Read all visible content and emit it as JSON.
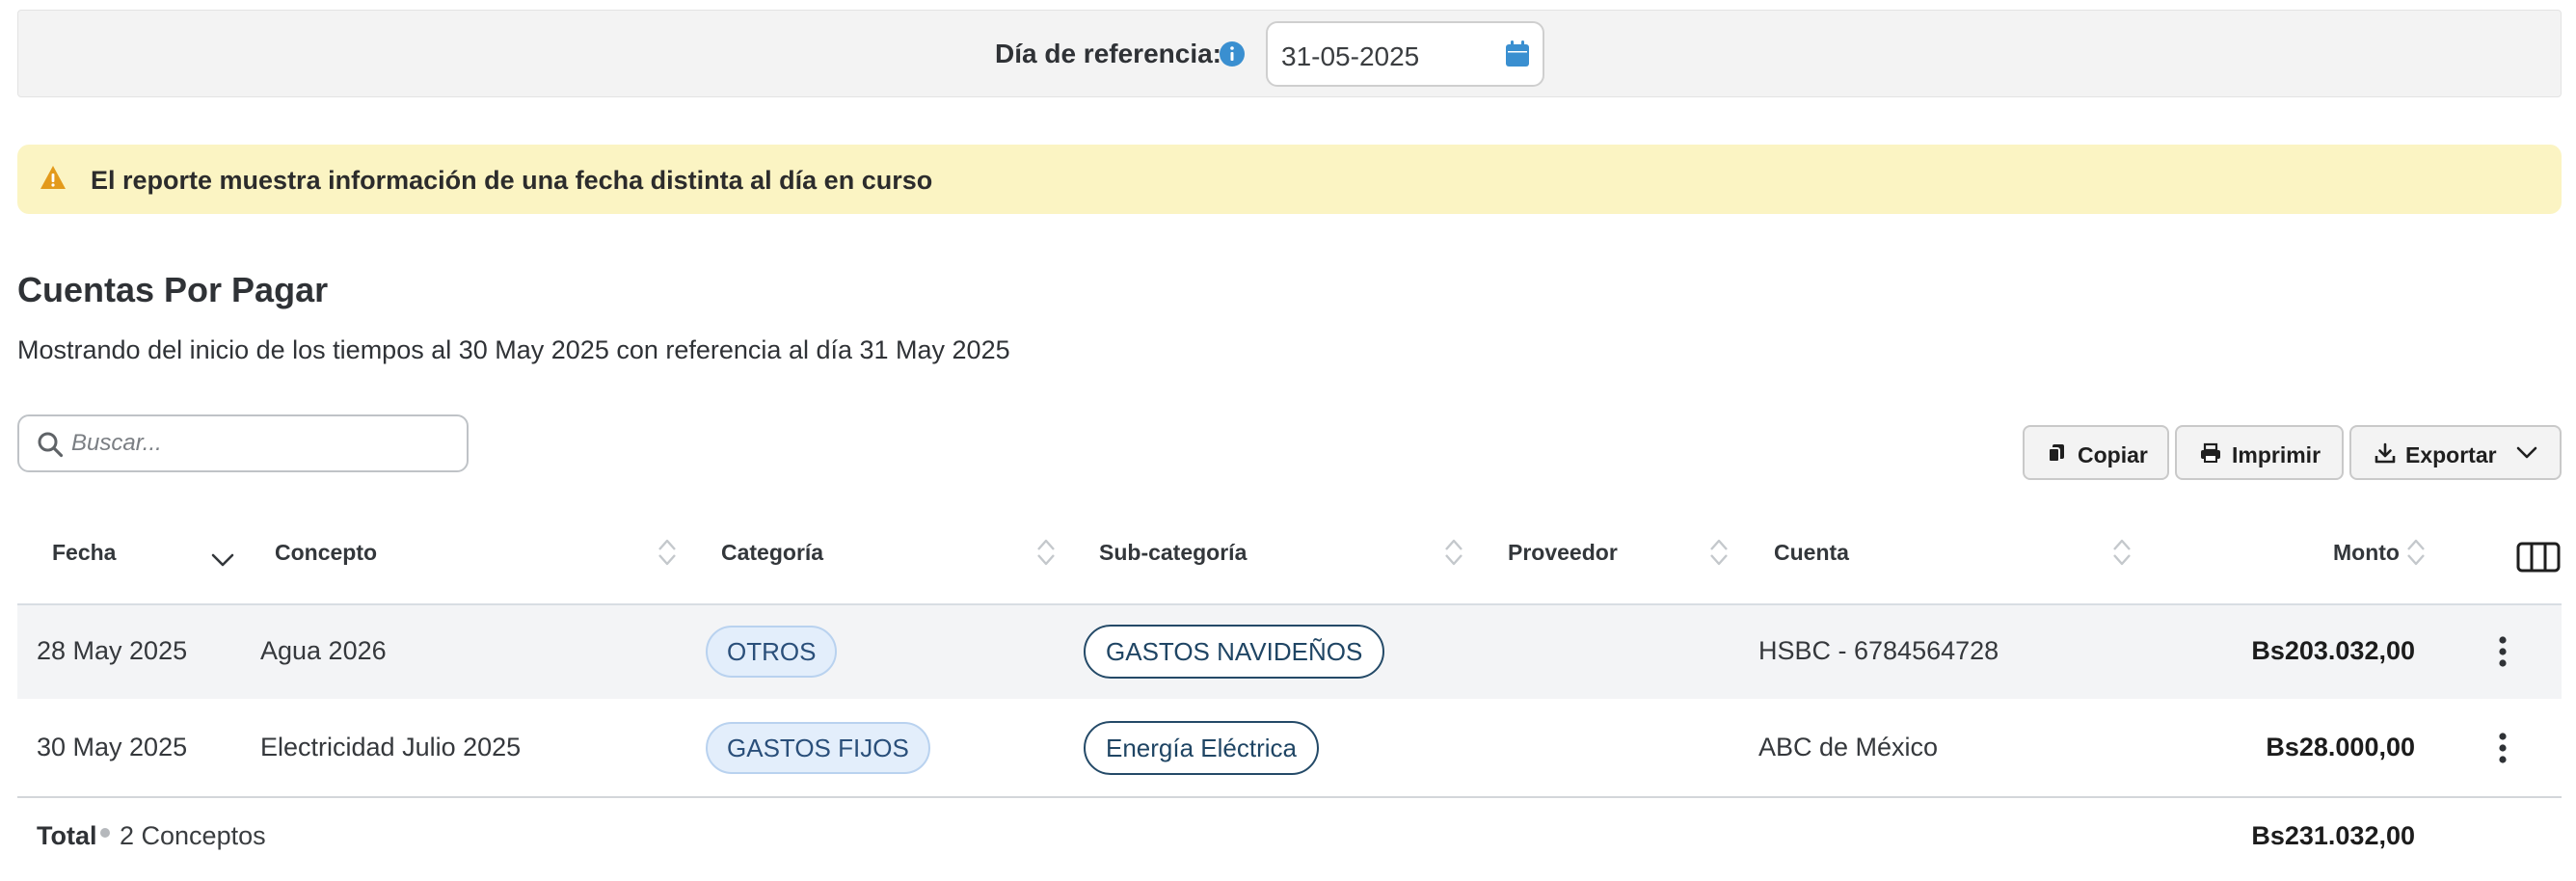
{
  "reference": {
    "label": "Día de referencia:",
    "date_value": "31-05-2025"
  },
  "alert": {
    "text": "El reporte muestra información de una fecha distinta al día en curso"
  },
  "page": {
    "title": "Cuentas Por Pagar",
    "subtitle": "Mostrando del inicio de los tiempos al 30 May 2025 con referencia al día 31 May 2025"
  },
  "search": {
    "placeholder": "Buscar..."
  },
  "toolbar": {
    "copy_label": "Copiar",
    "print_label": "Imprimir",
    "export_label": "Exportar"
  },
  "table": {
    "headers": {
      "fecha": "Fecha",
      "concepto": "Concepto",
      "categoria": "Categoría",
      "subcategoria": "Sub-categoría",
      "proveedor": "Proveedor",
      "cuenta": "Cuenta",
      "monto": "Monto"
    },
    "rows": [
      {
        "fecha": "28 May 2025",
        "concepto": "Agua 2026",
        "categoria": "OTROS",
        "subcategoria": "GASTOS NAVIDEÑOS",
        "proveedor": "",
        "cuenta": "HSBC - 6784564728",
        "monto": "Bs203.032,00"
      },
      {
        "fecha": "30 May 2025",
        "concepto": "Electricidad Julio 2025",
        "categoria": "GASTOS FIJOS",
        "subcategoria": "Energía Eléctrica",
        "proveedor": "",
        "cuenta": "ABC de México",
        "monto": "Bs28.000,00"
      }
    ],
    "footer": {
      "total_label": "Total",
      "count": "2 Conceptos",
      "total_amount": "Bs231.032,00"
    }
  },
  "colors": {
    "info_blue": "#3a8fd0",
    "calendar_blue": "#3a8fd0",
    "warning_orange": "#e39a1b",
    "alert_bg": "#fbf4c3",
    "chip_blue_bg": "#e3eefb",
    "chip_dark_border": "#244a68"
  },
  "icons": {
    "info": "info-icon",
    "calendar": "calendar-icon",
    "warning": "warning-icon",
    "search": "search-icon",
    "copy": "copy-icon",
    "print": "print-icon",
    "export": "download-icon",
    "dropdown": "chevron-down-icon",
    "columns": "columns-icon",
    "row_menu": "kebab-menu-icon"
  }
}
